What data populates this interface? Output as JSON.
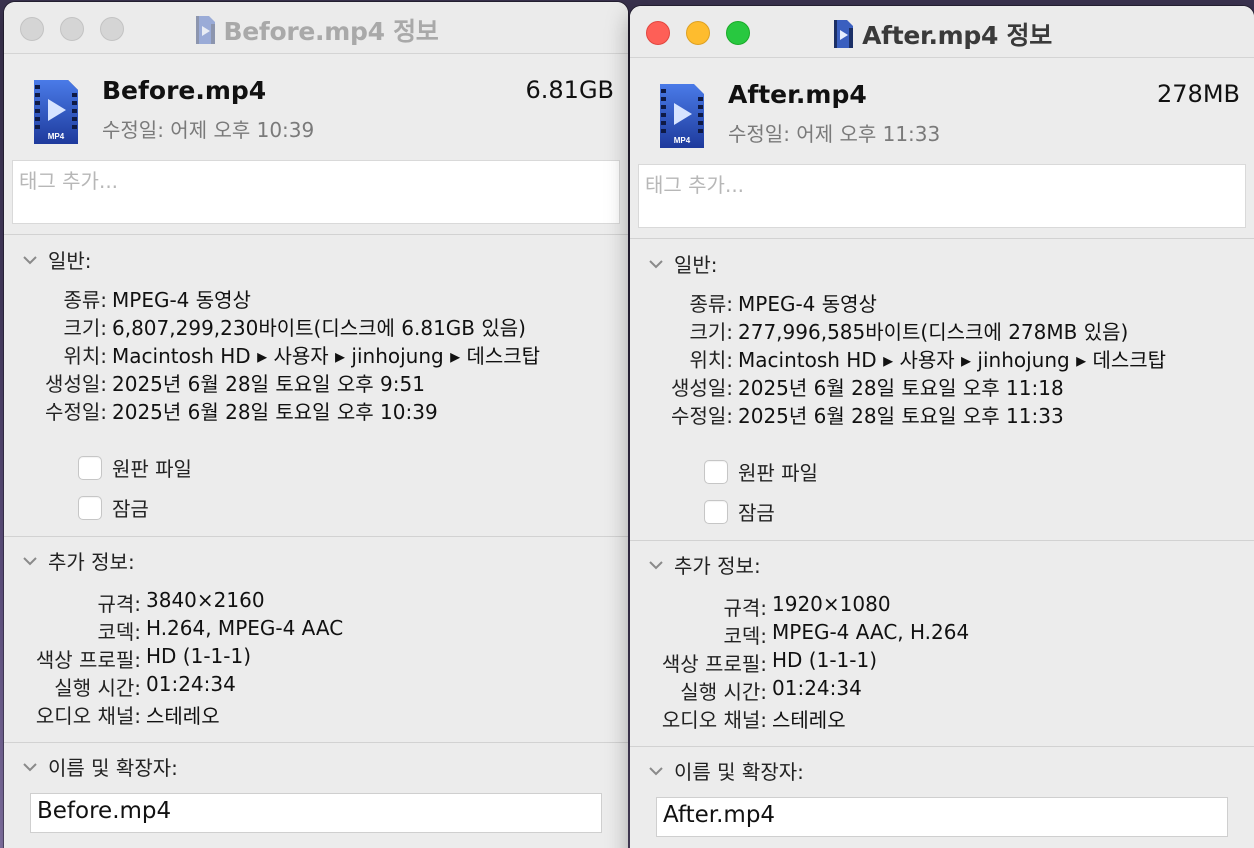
{
  "windows": [
    {
      "id": "before",
      "state": "inactive",
      "title": "Before.mp4 정보",
      "file_name": "Before.mp4",
      "file_size": "6.81GB",
      "modified_summary": "수정일: 어제 오후 10:39",
      "tags_placeholder": "태그 추가...",
      "file_badge": "MP4",
      "general": {
        "heading": "일반:",
        "kind_label": "종류:",
        "kind": "MPEG-4 동영상",
        "size_label": "크기:",
        "size": "6,807,299,230바이트(디스크에 6.81GB 있음)",
        "where_label": "위치:",
        "where": "Macintosh HD ▸ 사용자 ▸ jinhojung ▸ 데스크탑",
        "created_label": "생성일:",
        "created": "2025년 6월 28일 토요일 오후 9:51",
        "modified_label": "수정일:",
        "modified": "2025년 6월 28일 토요일 오후 10:39",
        "stationery_label": "원판 파일",
        "locked_label": "잠금"
      },
      "more_info": {
        "heading": "추가 정보:",
        "dimensions_label": "규격:",
        "dimensions": "3840×2160",
        "codecs_label": "코덱:",
        "codecs": "H.264, MPEG-4 AAC",
        "color_profile_label": "색상 프로필:",
        "color_profile": "HD (1-1-1)",
        "duration_label": "실행 시간:",
        "duration": "01:24:34",
        "audio_channels_label": "오디오 채널:",
        "audio_channels": "스테레오"
      },
      "name_ext": {
        "heading": "이름 및 확장자:",
        "value": "Before.mp4"
      }
    },
    {
      "id": "after",
      "state": "active",
      "title": "After.mp4 정보",
      "file_name": "After.mp4",
      "file_size": "278MB",
      "modified_summary": "수정일: 어제 오후 11:33",
      "tags_placeholder": "태그 추가...",
      "file_badge": "MP4",
      "general": {
        "heading": "일반:",
        "kind_label": "종류:",
        "kind": "MPEG-4 동영상",
        "size_label": "크기:",
        "size": "277,996,585바이트(디스크에 278MB 있음)",
        "where_label": "위치:",
        "where": "Macintosh HD ▸ 사용자 ▸ jinhojung ▸ 데스크탑",
        "created_label": "생성일:",
        "created": "2025년 6월 28일 토요일 오후 11:18",
        "modified_label": "수정일:",
        "modified": "2025년 6월 28일 토요일 오후 11:33",
        "stationery_label": "원판 파일",
        "locked_label": "잠금"
      },
      "more_info": {
        "heading": "추가 정보:",
        "dimensions_label": "규격:",
        "dimensions": "1920×1080",
        "codecs_label": "코덱:",
        "codecs": "MPEG-4 AAC, H.264",
        "color_profile_label": "색상 프로필:",
        "color_profile": "HD (1-1-1)",
        "duration_label": "실행 시간:",
        "duration": "01:24:34",
        "audio_channels_label": "오디오 채널:",
        "audio_channels": "스테레오"
      },
      "name_ext": {
        "heading": "이름 및 확장자:",
        "value": "After.mp4"
      }
    }
  ],
  "colors": {
    "close": "#fe5f57",
    "minimize": "#febc2e",
    "zoom": "#28c840",
    "file_icon_blue": "#2c5fd6"
  },
  "icons": {
    "file": "mp4-file-icon",
    "disclosure": "chevron-down-icon"
  }
}
